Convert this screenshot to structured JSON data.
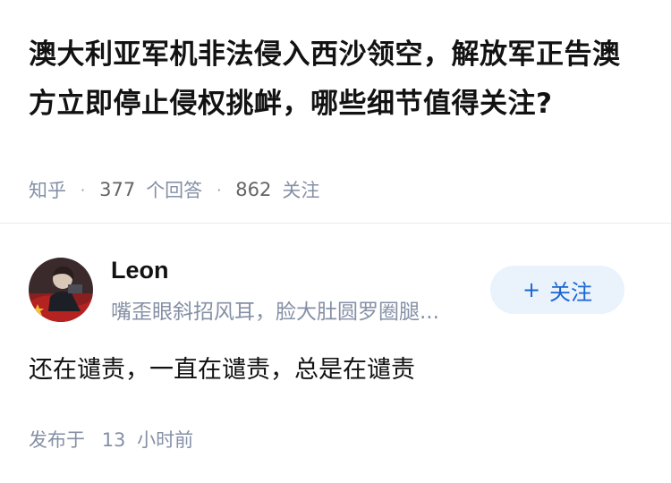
{
  "question": {
    "title": "澳大利亚军机非法侵入西沙领空，解放军正告澳方立即停止侵权挑衅，哪些细节值得关注?",
    "source": "知乎",
    "answers_count": "377",
    "answers_label": "个回答",
    "followers_count": "862",
    "followers_label": "关注"
  },
  "answer": {
    "author": {
      "name": "Leon",
      "bio": "嘴歪眼斜招风耳，脸大肚圆罗圈腿..."
    },
    "follow_button": {
      "icon": "+",
      "label": "关注"
    },
    "content": "还在谴责，一直在谴责，总是在谴责",
    "time_prefix": "发布于",
    "time_value": "13",
    "time_unit": "小时前"
  },
  "colors": {
    "accent": "#1966d2",
    "follow_bg": "#eaf2fc",
    "meta": "#8590a6",
    "text": "#121212"
  }
}
